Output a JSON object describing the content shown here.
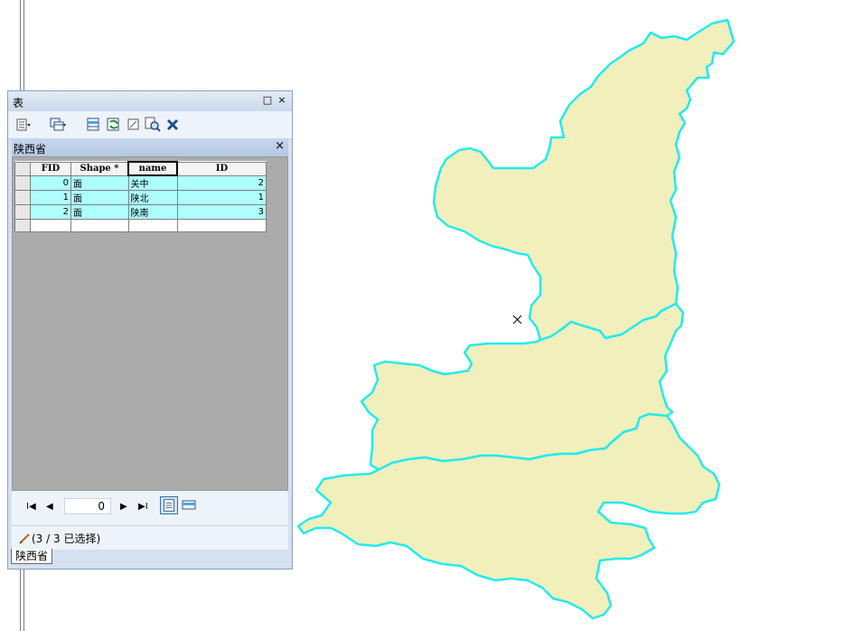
{
  "table_window": {
    "title": "表",
    "restore_icon": "□",
    "close_icon": "×",
    "toolbar": [
      "table-options-icon",
      "related-tables-icon",
      "select-by-attributes-icon",
      "switch-selection-icon",
      "clear-selection-icon",
      "zoom-to-selected-icon",
      "delete-selected-icon"
    ],
    "tab_title": "陕西省",
    "tab_close": "×",
    "columns": [
      "FID",
      "Shape *",
      "name",
      "ID"
    ],
    "rows": [
      {
        "fid": "0",
        "shape": "面",
        "name": "关中",
        "id": "2"
      },
      {
        "fid": "1",
        "shape": "面",
        "name": "陕北",
        "id": "1"
      },
      {
        "fid": "2",
        "shape": "面",
        "name": "陕南",
        "id": "3"
      }
    ],
    "nav": {
      "first": "I◀",
      "prev": "◀",
      "record": "0",
      "next": "▶",
      "last": "▶I"
    },
    "status": "(3 / 3 已选择)",
    "bottom_tab": "陕西省"
  },
  "map": {
    "fill_color": "#f1efbc",
    "outline_color": "#00e5ee",
    "cursor_icon": "×"
  }
}
